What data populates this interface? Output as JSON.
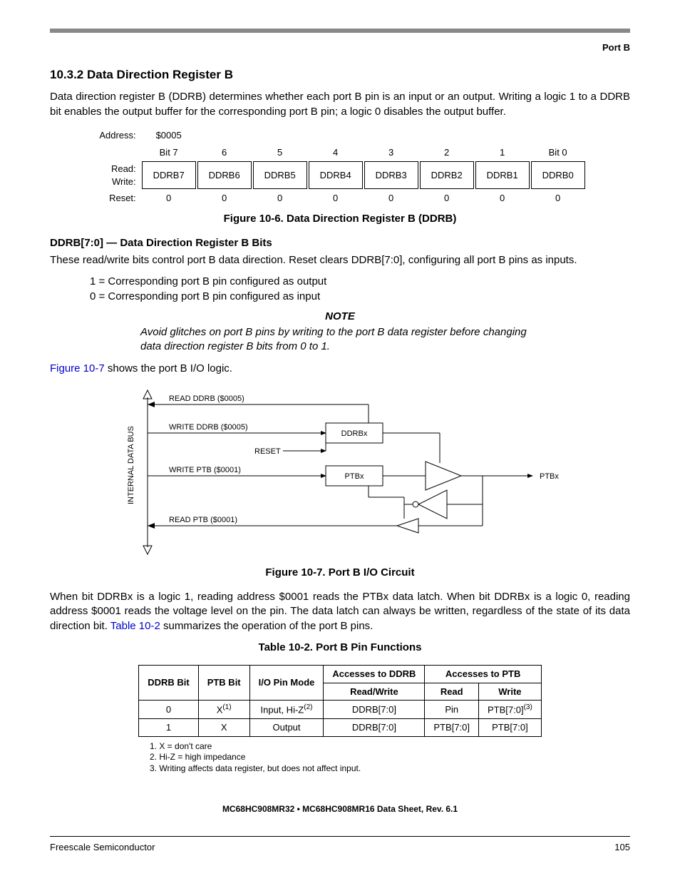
{
  "header": {
    "section_label": "Port B"
  },
  "section": {
    "number_title": "10.3.2  Data Direction Register B",
    "intro": "Data direction register B (DDRB) determines whether each port B pin is an input or an output. Writing a logic 1 to a DDRB bit enables the output buffer for the corresponding port B pin; a logic 0 disables the output buffer."
  },
  "register": {
    "address_label": "Address:",
    "address_value": "$0005",
    "bit_headers": [
      "Bit 7",
      "6",
      "5",
      "4",
      "3",
      "2",
      "1",
      "Bit 0"
    ],
    "rw_label_read": "Read:",
    "rw_label_write": "Write:",
    "bits": [
      "DDRB7",
      "DDRB6",
      "DDRB5",
      "DDRB4",
      "DDRB3",
      "DDRB2",
      "DDRB1",
      "DDRB0"
    ],
    "reset_label": "Reset:",
    "reset_values": [
      "0",
      "0",
      "0",
      "0",
      "0",
      "0",
      "0",
      "0"
    ],
    "caption": "Figure 10-6. Data Direction Register B (DDRB)"
  },
  "bits_desc": {
    "head": "DDRB[7:0] — Data Direction Register B Bits",
    "text": "These read/write bits control port B data direction. Reset clears DDRB[7:0], configuring all port B pins as inputs.",
    "one": "1 = Corresponding port B pin configured as output",
    "zero": "0 = Corresponding port B pin configured as input"
  },
  "note": {
    "head": "NOTE",
    "body": "Avoid glitches on port B pins by writing to the port B data register before changing data direction register B bits from 0 to 1."
  },
  "fig_ref": {
    "link": "Figure 10-7",
    "rest": " shows the port B I/O logic."
  },
  "circuit": {
    "bus_label": "INTERNAL DATA BUS",
    "read_ddrb": "READ DDRB ($0005)",
    "write_ddrb": "WRITE DDRB ($0005)",
    "reset": "RESET",
    "ddrbx": "DDRBx",
    "write_ptb": "WRITE PTB ($0001)",
    "ptbx": "PTBx",
    "read_ptb": "READ PTB ($0001)",
    "pin": "PTBx",
    "caption": "Figure 10-7. Port B I/O Circuit"
  },
  "after_circuit": {
    "text_a": "When bit DDRBx is a logic 1, reading address $0001 reads the PTBx data latch. When bit DDRBx is a logic 0, reading address $0001 reads the voltage level on the pin. The data latch can always be written, regardless of the state of its data direction bit. ",
    "table_link": "Table 10-2",
    "text_b": " summarizes the operation of the port B pins."
  },
  "table": {
    "caption": "Table 10-2. Port B Pin Functions",
    "headers": {
      "ddrb": "DDRB Bit",
      "ptb": "PTB Bit",
      "mode": "I/O Pin Mode",
      "acc_ddrb": "Accesses to DDRB",
      "acc_ptb": "Accesses to PTB",
      "rw": "Read/Write",
      "read": "Read",
      "write": "Write"
    },
    "rows": [
      {
        "ddrb": "0",
        "ptb": "X",
        "ptb_sup": "(1)",
        "mode": "Input, Hi-Z",
        "mode_sup": "(2)",
        "rw": "DDRB[7:0]",
        "read": "Pin",
        "write": "PTB[7:0]",
        "write_sup": "(3)"
      },
      {
        "ddrb": "1",
        "ptb": "X",
        "ptb_sup": "",
        "mode": "Output",
        "mode_sup": "",
        "rw": "DDRB[7:0]",
        "read": "PTB[7:0]",
        "write": "PTB[7:0]",
        "write_sup": ""
      }
    ],
    "footnotes": [
      "1. X = don't care",
      "2. Hi-Z = high impedance",
      "3. Writing affects data register, but does not affect input."
    ]
  },
  "footer": {
    "doc": "MC68HC908MR32 • MC68HC908MR16 Data Sheet, Rev. 6.1",
    "left": "Freescale Semiconductor",
    "right": "105"
  }
}
